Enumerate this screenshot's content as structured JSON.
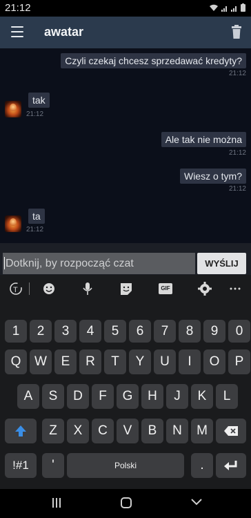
{
  "status": {
    "time": "21:12"
  },
  "appbar": {
    "title": "awatar"
  },
  "messages": [
    {
      "text": "Czyli czekaj chcesz sprzedawać kredyty?",
      "time": "21:12",
      "side": "right"
    },
    {
      "text": "tak",
      "time": "21:12",
      "side": "left"
    },
    {
      "text": "Ale tak nie można",
      "time": "21:12",
      "side": "right"
    },
    {
      "text": "Wiesz o tym?",
      "time": "21:12",
      "side": "right"
    },
    {
      "text": "ta",
      "time": "21:12",
      "side": "left"
    }
  ],
  "composer": {
    "placeholder": "Dotknij, by rozpocząć czat",
    "send_label": "WYŚLIJ"
  },
  "keyboard": {
    "toolbar_gif": "GIF",
    "numbers": [
      "1",
      "2",
      "3",
      "4",
      "5",
      "6",
      "7",
      "8",
      "9",
      "0"
    ],
    "row1": [
      "Q",
      "W",
      "E",
      "R",
      "T",
      "Y",
      "U",
      "I",
      "O",
      "P"
    ],
    "row2": [
      "A",
      "S",
      "D",
      "F",
      "G",
      "H",
      "J",
      "K",
      "L"
    ],
    "row3": [
      "Z",
      "X",
      "C",
      "V",
      "B",
      "N",
      "M"
    ],
    "symbols_label": "!#1",
    "apostrophe": "'",
    "space_label": "Polski",
    "period": "."
  },
  "colors": {
    "appbar": "#2b3a4d",
    "chat_bg": "#0b0f1a",
    "bubble": "#2e3444",
    "shift_accent": "#3a8ee6"
  }
}
